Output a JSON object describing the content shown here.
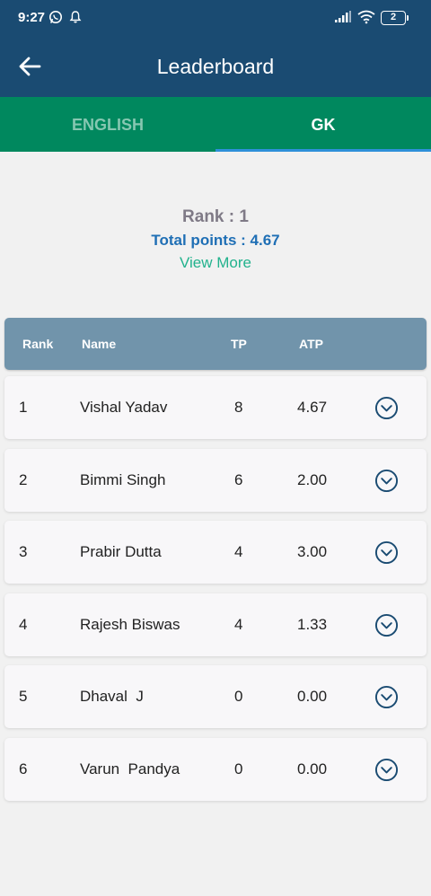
{
  "status_bar": {
    "time": "9:27",
    "battery": "2",
    "icons": [
      "whatsapp-icon",
      "notification-bell-icon",
      "signal-icon",
      "wifi-icon",
      "battery-icon"
    ]
  },
  "app_bar": {
    "title": "Leaderboard",
    "back_icon": "arrow-left-icon"
  },
  "tabs": [
    {
      "label": "ENGLISH",
      "selected": false
    },
    {
      "label": "GK",
      "selected": true
    }
  ],
  "summary": {
    "rank": "Rank : 1",
    "total_points": "Total points : 4.67",
    "view_more": "View More"
  },
  "table": {
    "headers": {
      "rank": "Rank",
      "name": "Name",
      "tp": "TP",
      "atp": "ATP"
    },
    "rows": [
      {
        "rank": "1",
        "name": "Vishal Yadav",
        "tp": "8",
        "atp": "4.67"
      },
      {
        "rank": "2",
        "name": "Bimmi Singh",
        "tp": "6",
        "atp": "2.00"
      },
      {
        "rank": "3",
        "name": "Prabir Dutta",
        "tp": "4",
        "atp": "3.00"
      },
      {
        "rank": "4",
        "name": "Rajesh Biswas",
        "tp": "4",
        "atp": "1.33"
      },
      {
        "rank": "5",
        "name": "Dhaval  J",
        "tp": "0",
        "atp": "0.00"
      },
      {
        "rank": "6",
        "name": "Varun  Pandya",
        "tp": "0",
        "atp": "0.00"
      }
    ],
    "expand_icon": "chevron-down-circle-icon"
  },
  "colors": {
    "app_bar": "#1a4b72",
    "tab_bar": "#00885e",
    "tab_indicator": "#2e90d9",
    "table_header": "#7194ab",
    "points_text": "#1f6fb5",
    "view_more_text": "#22b28d"
  }
}
